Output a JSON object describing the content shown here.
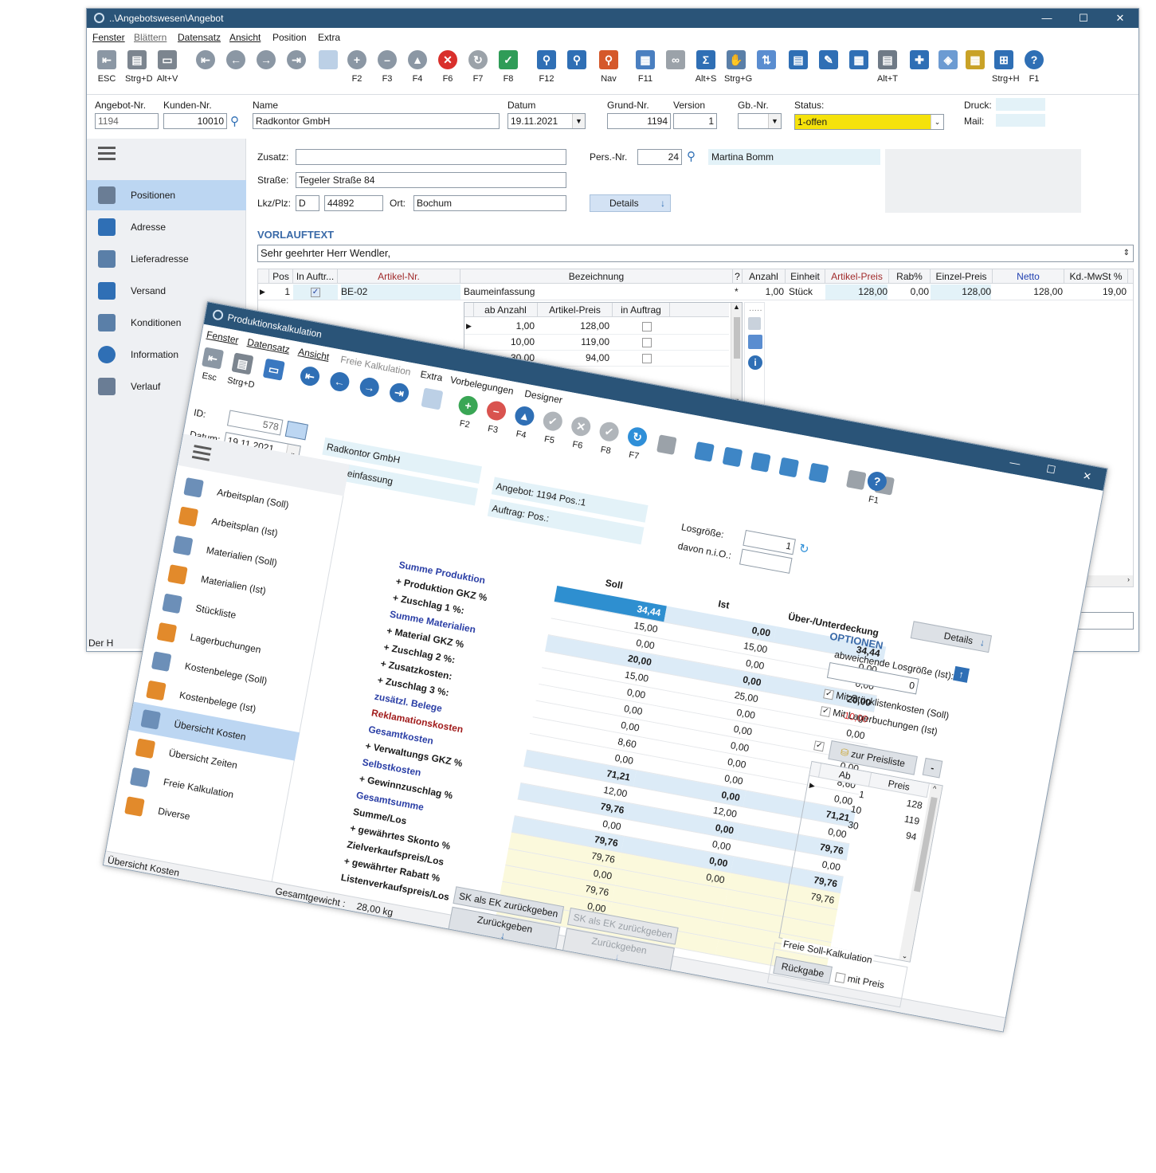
{
  "win1": {
    "title": "..\\Angebotswesen\\Angebot",
    "window_controls": [
      "—",
      "☐",
      "✕"
    ],
    "menu": [
      "Fenster",
      "Blättern",
      "Datensatz",
      "Ansicht",
      "Position",
      "Extra"
    ],
    "toolbar": [
      {
        "label": "ESC",
        "icon": "exit-icon"
      },
      {
        "label": "Strg+D",
        "icon": "printer-icon"
      },
      {
        "label": "Alt+V",
        "icon": "monitor-icon"
      },
      {
        "label": "",
        "icon": "first-record-icon"
      },
      {
        "label": "",
        "icon": "previous-record-icon"
      },
      {
        "label": "",
        "icon": "next-record-icon"
      },
      {
        "label": "",
        "icon": "last-record-icon"
      },
      {
        "label": "",
        "icon": "blank-record-icon"
      },
      {
        "label": "F2",
        "icon": "add-icon"
      },
      {
        "label": "F3",
        "icon": "remove-icon"
      },
      {
        "label": "F4",
        "icon": "up-icon"
      },
      {
        "label": "F6",
        "icon": "cancel-icon"
      },
      {
        "label": "F7",
        "icon": "refresh-icon"
      },
      {
        "label": "F8",
        "icon": "save-check-icon"
      },
      {
        "label": "F12",
        "icon": "search-icon"
      },
      {
        "label": "",
        "icon": "search-table-icon"
      },
      {
        "label": "Nav",
        "icon": "nav-search-icon"
      },
      {
        "label": "F11",
        "icon": "calendar-window-icon"
      },
      {
        "label": "",
        "icon": "link-icon"
      },
      {
        "label": "Alt+S",
        "icon": "sum-icon"
      },
      {
        "label": "Strg+G",
        "icon": "handshake-icon"
      },
      {
        "label": "",
        "icon": "sort-icon"
      },
      {
        "label": "",
        "icon": "certificate-icon"
      },
      {
        "label": "",
        "icon": "tag-icon"
      },
      {
        "label": "",
        "icon": "calculator-icon"
      },
      {
        "label": "Alt+T",
        "icon": "document-icon"
      },
      {
        "label": "",
        "icon": "puzzle-icon"
      },
      {
        "label": "",
        "icon": "network-icon"
      },
      {
        "label": "",
        "icon": "clipboard-icon"
      },
      {
        "label": "Strg+H",
        "icon": "org-chart-icon"
      },
      {
        "label": "F1",
        "icon": "help-icon"
      }
    ],
    "header": {
      "angebot_nr_label": "Angebot-Nr.",
      "angebot_nr": "1194",
      "kunden_nr_label": "Kunden-Nr.",
      "kunden_nr": "10010",
      "name_label": "Name",
      "name": "Radkontor GmbH",
      "datum_label": "Datum",
      "datum": "19.11.2021",
      "grund_nr_label": "Grund-Nr.",
      "grund_nr": "1194",
      "version_label": "Version",
      "version": "1",
      "gb_nr_label": "Gb.-Nr.",
      "gb_nr": "",
      "status_label": "Status:",
      "status": "1-offen",
      "druck_label": "Druck:",
      "mail_label": "Mail:"
    },
    "sidebar": [
      "Positionen",
      "Adresse",
      "Lieferadresse",
      "Versand",
      "Konditionen",
      "Information",
      "Verlauf"
    ],
    "address": {
      "zusatz_label": "Zusatz:",
      "zusatz": "",
      "strasse_label": "Straße:",
      "strasse": "Tegeler Straße 84",
      "plz_label": "Lkz/Plz:",
      "lkz": "D",
      "plz": "44892",
      "ort_label": "Ort:",
      "ort": "Bochum",
      "pers_label": "Pers.-Nr.",
      "pers_nr": "24",
      "pers_name": "Martina Bomm",
      "details_label": "Details"
    },
    "vorlauf_label": "VORLAUFTEXT",
    "vorlauf_text": "Sehr geehrter Herr Wendler,",
    "grid_headers": [
      "Pos",
      "In Auftr...",
      "Artikel-Nr.",
      "Bezeichnung",
      "?",
      "Anzahl",
      "Einheit",
      "Artikel-Preis",
      "Rab%",
      "Einzel-Preis",
      "Netto",
      "Kd.-MwSt %"
    ],
    "grid_row": {
      "pos": "1",
      "artikel": "BE-02",
      "bezeichnung": "Baumeinfassung",
      "q": "*",
      "anzahl": "1,00",
      "einheit": "Stück",
      "artikel_preis": "128,00",
      "rab": "0,00",
      "einzel_preis": "128,00",
      "netto": "128,00",
      "mwst": "19,00"
    },
    "sub_headers": [
      "ab Anzahl",
      "Artikel-Preis",
      "in Auftrag"
    ],
    "sub_rows": [
      [
        "1,00",
        "128,00"
      ],
      [
        "10,00",
        "119,00"
      ],
      [
        "30,00",
        "94,00"
      ]
    ],
    "status_left": "Der H"
  },
  "win2": {
    "title": "Produktionskalkulation",
    "window_controls": [
      "—",
      "☐",
      "✕"
    ],
    "menu": [
      "Fenster",
      "Datensatz",
      "Ansicht",
      "Freie Kalkulation",
      "Extra",
      "Vorbelegungen",
      "Designer"
    ],
    "toolbar_left": [
      {
        "label": "Esc"
      },
      {
        "label": "Strg+D"
      },
      {
        "label": ""
      }
    ],
    "toolbar_right": [
      {
        "label": "F2",
        "color": "#3aa655",
        "glyph": "+"
      },
      {
        "label": "F3",
        "color": "#d9534f",
        "glyph": "–"
      },
      {
        "label": "F4",
        "color": "#2f6fb5",
        "glyph": "▲"
      },
      {
        "label": "F5",
        "color": "#b0b5ba",
        "glyph": "✓"
      },
      {
        "label": "F6",
        "color": "#b0b5ba",
        "glyph": "✕"
      },
      {
        "label": "F8",
        "color": "#b0b5ba",
        "glyph": "✓"
      },
      {
        "label": "F7",
        "color": "#2f8fd8",
        "glyph": "↻"
      }
    ],
    "id_label": "ID:",
    "id": "578",
    "datum_label": "Datum:",
    "datum": "19.11.2021",
    "customer": "Radkontor GmbH",
    "article": "Baumeinfassung",
    "angebot_ref": "Angebot: 1194 Pos.:1",
    "auftrag_ref": "Auftrag:  Pos.:",
    "losgroesse_label": "Losgröße:",
    "losgroesse": "1",
    "niO_label": "davon n.i.O.:",
    "niO": "",
    "help_label": "F1",
    "sidebar": [
      "Arbeitsplan (Soll)",
      "Arbeitsplan (Ist)",
      "Materialien (Soll)",
      "Materialien (Ist)",
      "Stückliste",
      "Lagerbuchungen",
      "Kostenbelege (Soll)",
      "Kostenbelege (Ist)",
      "Übersicht Kosten",
      "Übersicht Zeiten",
      "Freie Kalkulation",
      "Diverse"
    ],
    "col_soll": "Soll",
    "col_ist": "Ist",
    "col_diff": "Über-/Unterdeckung",
    "rows": [
      {
        "label": "Summe Produktion",
        "soll": "34,44",
        "ist": "0,00",
        "diff": "34,44"
      },
      {
        "label": "+ Produktion GKZ %",
        "soll": "15,00",
        "ist": "15,00",
        "diff": "0,00"
      },
      {
        "label": "+ Zuschlag 1 %:",
        "soll": "0,00",
        "ist": "0,00",
        "diff": "0,00"
      },
      {
        "label": "Summe Materialien",
        "soll": "20,00",
        "ist": "0,00",
        "diff": "20,00"
      },
      {
        "label": "+ Material GKZ %",
        "soll": "15,00",
        "ist": "25,00",
        "diff": "-10,00"
      },
      {
        "label": "+ Zuschlag 2 %:",
        "soll": "0,00",
        "ist": "0,00",
        "diff": "0,00"
      },
      {
        "label": "+ Zusatzkosten:",
        "soll": "0,00",
        "ist": "0,00",
        "diff": "0,00"
      },
      {
        "label": "+ Zuschlag 3 %:",
        "soll": "0,00",
        "ist": "0,00",
        "diff": "0,00"
      },
      {
        "label": "zusätzl. Belege",
        "soll": "8,60",
        "ist": "0,00",
        "diff": "8,60"
      },
      {
        "label": "Reklamationskosten",
        "soll": "0,00",
        "ist": "0,00",
        "diff": "0,00"
      },
      {
        "label": "Gesamtkosten",
        "soll": "71,21",
        "ist": "0,00",
        "diff": "71,21"
      },
      {
        "label": "+ Verwaltungs GKZ %",
        "soll": "12,00",
        "ist": "12,00",
        "diff": "0,00"
      },
      {
        "label": "Selbstkosten",
        "soll": "79,76",
        "ist": "0,00",
        "diff": "79,76"
      },
      {
        "label": "+ Gewinnzuschlag %",
        "soll": "0,00",
        "ist": "0,00",
        "diff": "0,00"
      },
      {
        "label": "Gesamtsumme",
        "soll": "79,76",
        "ist": "0,00",
        "diff": "79,76"
      },
      {
        "label": "Summe/Los",
        "soll": "79,76",
        "ist": "0,00",
        "diff": "79,76"
      },
      {
        "label": "+ gewährtes Skonto %",
        "soll": "0,00",
        "ist": "",
        "diff": ""
      },
      {
        "label": "Zielverkaufspreis/Los",
        "soll": "79,76",
        "ist": "",
        "diff": ""
      },
      {
        "label": "+ gewährter Rabatt %",
        "soll": "0,00",
        "ist": "",
        "diff": ""
      },
      {
        "label": "Listenverkaufspreis/Los",
        "soll": "79,76",
        "ist": "",
        "diff": ""
      }
    ],
    "btn_sk_ek": "SK als EK zurückgeben",
    "btn_zurueck": "Zurückgeben",
    "details_label": "Details",
    "optionen_label": "OPTIONEN",
    "abw_los_label": "abweichende Losgröße (Ist):",
    "abw_los": "0",
    "cb_stueckliste": "Mit Stücklistenkosten (Soll)",
    "cb_lager": "Mit Lagerbuchungen (Ist)",
    "preisliste_btn": "zur  Preisliste",
    "minus_btn": "-",
    "price_headers": [
      "Ab",
      "Preis"
    ],
    "price_rows": [
      [
        "1",
        "128"
      ],
      [
        "10",
        "119"
      ],
      [
        "30",
        "94"
      ]
    ],
    "freie_label": "Freie Soll-Kalkulation",
    "rueckgabe_btn": "Rückgabe",
    "mit_preis": "mit Preis",
    "status_left": "Übersicht Kosten",
    "gesamtgewicht_label": "Gesamtgewicht :",
    "gesamtgewicht": "28,00 kg"
  },
  "colors": {
    "titlebar": "#2a5478",
    "accent": "#2f6fb5",
    "status_yellow": "#f5e20b",
    "selected_nav": "#bcd6f2",
    "negative": "#d62828"
  }
}
